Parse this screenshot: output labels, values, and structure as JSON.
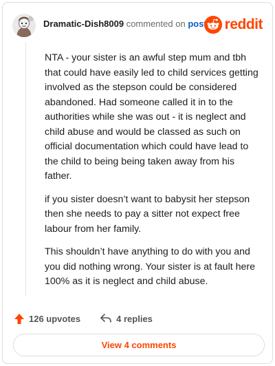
{
  "comment": {
    "username": "Dramatic-Dish8009",
    "commented_text": "commented on",
    "post_link": "post",
    "brand_word": "reddit",
    "paragraphs": [
      "NTA - your sister is an awful step mum and tbh that could have easily led to child services getting involved as the stepson could be considered abandoned. Had someone called it in to the authorities while she was out - it is neglect and child abuse and would be classed as such on official documentation which could have lead to the child to being being taken away from his father.",
      "if you sister doesn’t want to babysit her stepson then she needs to pay a sitter not expect free labour from her family.",
      "This shouldn’t have anything to do with you and you did nothing wrong. Your sister is at fault here 100% as it is neglect and child abuse."
    ],
    "upvotes_label": "126 upvotes",
    "replies_label": "4 replies",
    "view_comments_label": "View 4 comments"
  },
  "icons": {
    "avatar": "avatar-icon",
    "brand": "reddit-logo-icon",
    "upvote": "upvote-arrow-icon",
    "reply": "reply-arrow-icon"
  },
  "colors": {
    "accent": "#ff4500",
    "link": "#0a5fbf",
    "muted": "#6a6a6a"
  }
}
